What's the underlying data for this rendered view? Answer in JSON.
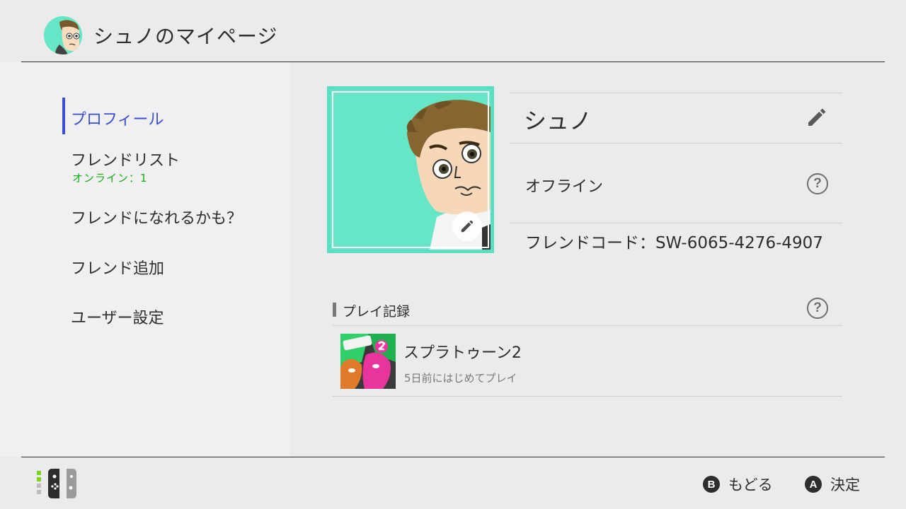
{
  "header": {
    "title": "シュノのマイページ",
    "avatar_color": "#66e6c7"
  },
  "sidebar": {
    "items": [
      {
        "label": "プロフィール",
        "active": true
      },
      {
        "label": "フレンドリスト",
        "sub": "オンライン：1"
      },
      {
        "label": "フレンドになれるかも？"
      },
      {
        "label": "フレンド追加"
      },
      {
        "label": "ユーザー設定"
      }
    ],
    "accent_color": "#3b4ed8"
  },
  "profile": {
    "name": "シュノ",
    "status": "オフライン",
    "friend_code": "フレンドコード：SW-6065-4276-4907",
    "help_icon": "?"
  },
  "play_history": {
    "title": "プレイ記録",
    "help_icon": "?",
    "games": [
      {
        "title": "スプラトゥーン2",
        "subtitle": "5日前にはじめてプレイ"
      }
    ]
  },
  "footer": {
    "back": {
      "key": "B",
      "label": "もどる"
    },
    "confirm": {
      "key": "A",
      "label": "決定"
    }
  },
  "icons": {
    "pencil": "pencil-icon",
    "help": "help-icon",
    "controller": "joycon-icon"
  }
}
